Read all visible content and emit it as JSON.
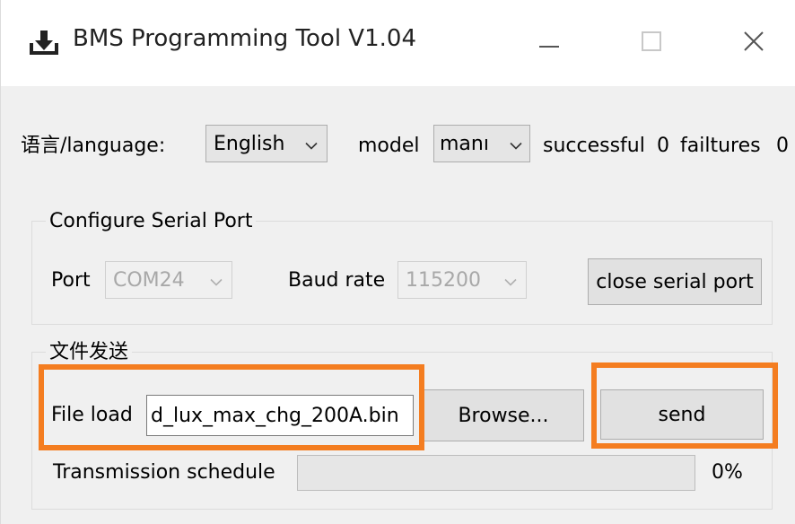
{
  "window": {
    "title": "BMS Programming Tool V1.04",
    "icons": {
      "app": "download-icon",
      "minimize": "minimize-icon",
      "maximize": "maximize-icon",
      "close": "close-icon"
    }
  },
  "top_row": {
    "language_label": "语言/language:",
    "language_value": "English",
    "model_label": "model",
    "model_value": "manı",
    "successful_label": "successful",
    "successful_count": "0",
    "failures_label": "failtures",
    "failures_count": "0"
  },
  "serial_port": {
    "group_title": "Configure Serial Port",
    "port_label": "Port",
    "port_value": "COM24",
    "baud_label": "Baud rate",
    "baud_value": "115200",
    "close_button": "close serial port"
  },
  "file_send": {
    "group_title": "文件发送",
    "file_load_label": "File load",
    "file_path": "d_lux_max_chg_200A.bin",
    "browse_button": "Browse...",
    "send_button": "send",
    "progress_label": "Transmission schedule",
    "progress_value": 0,
    "progress_text": "0%"
  },
  "colors": {
    "highlight": "#f47d20",
    "window_bg": "#f0f0f0"
  }
}
